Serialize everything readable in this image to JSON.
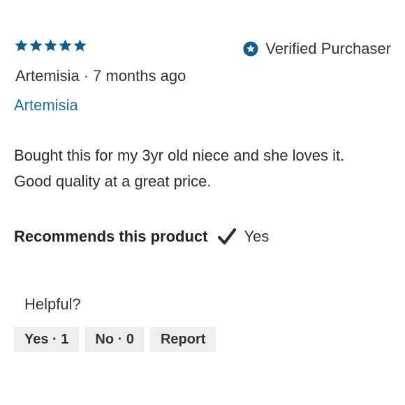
{
  "review": {
    "rating": 5,
    "rating_max": 5,
    "star_color": "#0f5e8f",
    "verified_label": "Verified Purchaser",
    "verified_icon": "star-badge-icon",
    "author": "Artemisia",
    "separator": "·",
    "age": "7 months ago",
    "author_link": "Artemisia",
    "text": "Bought this for my 3yr old niece and she loves it. Good quality at a great price.",
    "recommends_label": "Recommends this product",
    "recommends_icon": "checkmark-icon",
    "recommends_value": "Yes"
  },
  "helpful": {
    "label": "Helpful?",
    "yes_label": "Yes · 1",
    "no_label": "No · 0",
    "report_label": "Report"
  }
}
